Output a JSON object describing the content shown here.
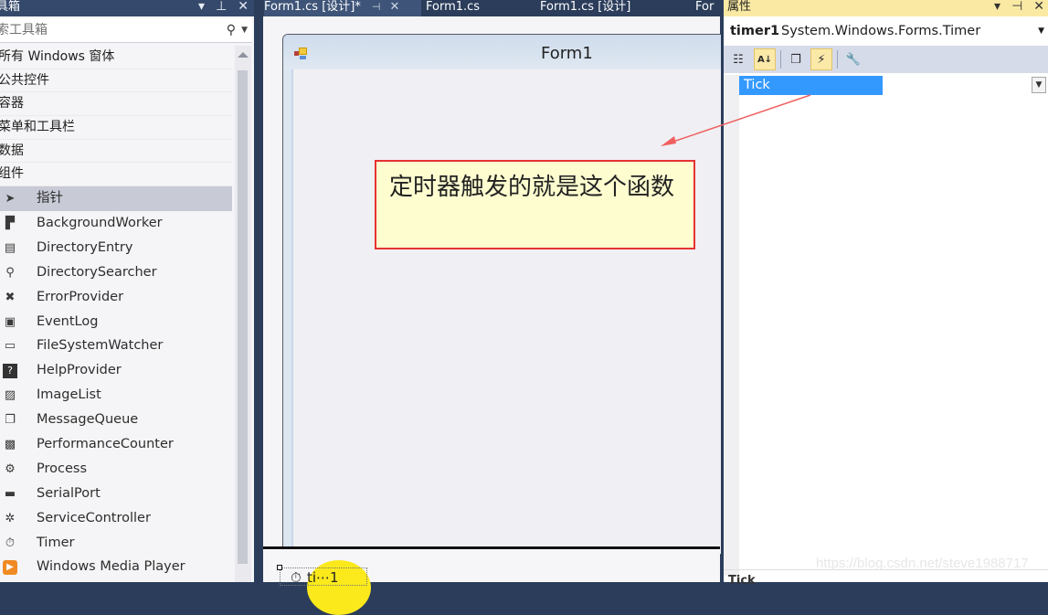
{
  "toolbox": {
    "title": "具箱",
    "search_placeholder": "索工具箱",
    "search_icon": "search-icon",
    "categories": [
      {
        "label": "所有 Windows 窗体"
      },
      {
        "label": "公共控件"
      },
      {
        "label": "容器"
      },
      {
        "label": "菜单和工具栏"
      },
      {
        "label": "数据"
      },
      {
        "label": "组件"
      }
    ],
    "items": [
      {
        "label": "指针",
        "icon": "pointer-icon",
        "selected": true
      },
      {
        "label": "BackgroundWorker",
        "icon": "background-worker-icon"
      },
      {
        "label": "DirectoryEntry",
        "icon": "directory-entry-icon"
      },
      {
        "label": "DirectorySearcher",
        "icon": "directory-searcher-icon"
      },
      {
        "label": "ErrorProvider",
        "icon": "error-provider-icon"
      },
      {
        "label": "EventLog",
        "icon": "event-log-icon"
      },
      {
        "label": "FileSystemWatcher",
        "icon": "file-system-watcher-icon"
      },
      {
        "label": "HelpProvider",
        "icon": "help-provider-icon"
      },
      {
        "label": "ImageList",
        "icon": "image-list-icon"
      },
      {
        "label": "MessageQueue",
        "icon": "message-queue-icon"
      },
      {
        "label": "PerformanceCounter",
        "icon": "performance-counter-icon"
      },
      {
        "label": "Process",
        "icon": "process-icon"
      },
      {
        "label": "SerialPort",
        "icon": "serial-port-icon"
      },
      {
        "label": "ServiceController",
        "icon": "service-controller-icon"
      },
      {
        "label": "Timer",
        "icon": "timer-icon"
      },
      {
        "label": "Windows Media Player",
        "icon": "media-player-icon"
      }
    ]
  },
  "designer": {
    "tabs": [
      {
        "label": "Form1.cs [设计]*",
        "active": true
      },
      {
        "label": "Form1.cs"
      },
      {
        "label": "Form1.cs [设计]"
      },
      {
        "label": "For"
      }
    ],
    "form_title": "Form1",
    "tray_component": "timer1",
    "tray_component_visible": "ti⋯1"
  },
  "callout": {
    "text": "定时器触发的就是这个函数",
    "border_color": "#e53333",
    "background": "#fdfdd0"
  },
  "properties": {
    "title": "属性",
    "object_name": "timer1",
    "object_type": "System.Windows.Forms.Timer",
    "toolbar": [
      "categorized",
      "alphabetical",
      "properties",
      "events",
      "property-pages"
    ],
    "events": [
      {
        "name": "Tick",
        "value": "",
        "selected": true
      }
    ],
    "description_label": "Tick"
  },
  "watermark": "https://blog.csdn.net/steve1988717",
  "colors": {
    "chrome": "#2b3d5b",
    "active_panel": "#f9e9a3",
    "selection": "#3399ff"
  }
}
